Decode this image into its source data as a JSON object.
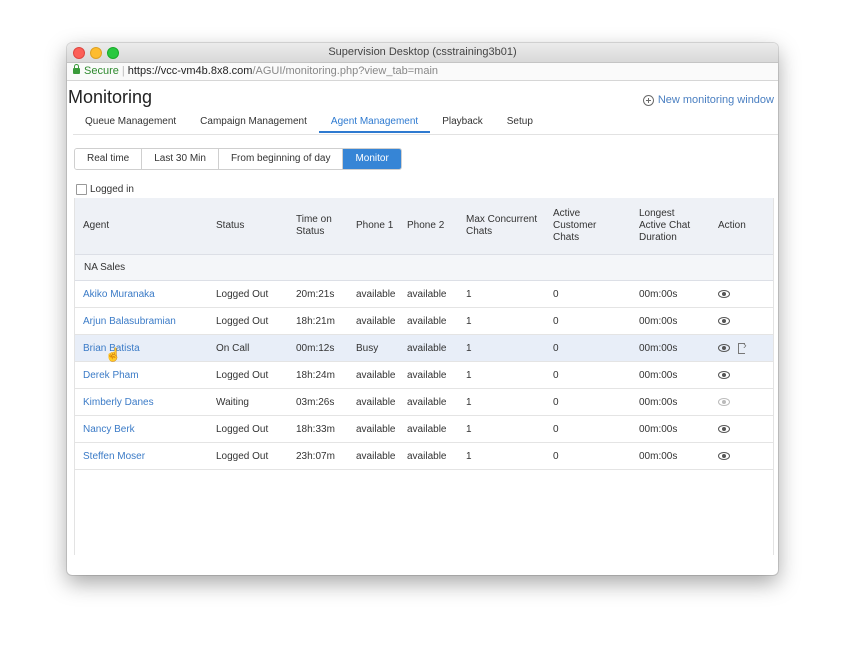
{
  "window": {
    "title": "Supervision Desktop (csstraining3b01)"
  },
  "address": {
    "secure_label": "Secure",
    "url_main": "https://vcc-vm4b.8x8.com",
    "url_rest": "/AGUI/monitoring.php?view_tab=main"
  },
  "page": {
    "title": "Monitoring",
    "new_window_label": "New monitoring window"
  },
  "tabs": [
    "Queue Management",
    "Campaign Management",
    "Agent Management",
    "Playback",
    "Setup"
  ],
  "active_tab": "Agent Management",
  "time_buttons": [
    "Real time",
    "Last 30 Min",
    "From beginning of day",
    "Monitor"
  ],
  "active_time_button": "Monitor",
  "filter": {
    "logged_in_label": "Logged in"
  },
  "table": {
    "headers": {
      "agent": "Agent",
      "status": "Status",
      "time_on_status_1": "Time on",
      "time_on_status_2": "Status",
      "phone1": "Phone 1",
      "phone2": "Phone 2",
      "max_1": "Max Concurrent",
      "max_2": "Chats",
      "active_1": "Active",
      "active_2": "Customer",
      "active_3": "Chats",
      "longest_1": "Longest",
      "longest_2": "Active Chat",
      "longest_3": "Duration",
      "action": "Action"
    },
    "group": "NA Sales",
    "rows": [
      {
        "agent": "Akiko Muranaka",
        "status": "Logged Out",
        "time": "20m:21s",
        "phone1": "available",
        "phone2": "available",
        "max": "1",
        "active": "0",
        "longest": "00m:00s"
      },
      {
        "agent": "Arjun Balasubramian",
        "status": "Logged Out",
        "time": "18h:21m",
        "phone1": "available",
        "phone2": "available",
        "max": "1",
        "active": "0",
        "longest": "00m:00s"
      },
      {
        "agent": "Brian Batista",
        "status": "On Call",
        "time": "00m:12s",
        "phone1": "Busy",
        "phone2": "available",
        "max": "1",
        "active": "0",
        "longest": "00m:00s"
      },
      {
        "agent": "Derek Pham",
        "status": "Logged Out",
        "time": "18h:24m",
        "phone1": "available",
        "phone2": "available",
        "max": "1",
        "active": "0",
        "longest": "00m:00s"
      },
      {
        "agent": "Kimberly Danes",
        "status": "Waiting",
        "time": "03m:26s",
        "phone1": "available",
        "phone2": "available",
        "max": "1",
        "active": "0",
        "longest": "00m:00s"
      },
      {
        "agent": "Nancy Berk",
        "status": "Logged Out",
        "time": "18h:33m",
        "phone1": "available",
        "phone2": "available",
        "max": "1",
        "active": "0",
        "longest": "00m:00s"
      },
      {
        "agent": "Steffen Moser",
        "status": "Logged Out",
        "time": "23h:07m",
        "phone1": "available",
        "phone2": "available",
        "max": "1",
        "active": "0",
        "longest": "00m:00s"
      }
    ]
  },
  "colors": {
    "accent": "#3685d6",
    "link": "#3b7bc7",
    "header_bg": "#eef1f6",
    "highlight_row": "#e8eef8"
  }
}
